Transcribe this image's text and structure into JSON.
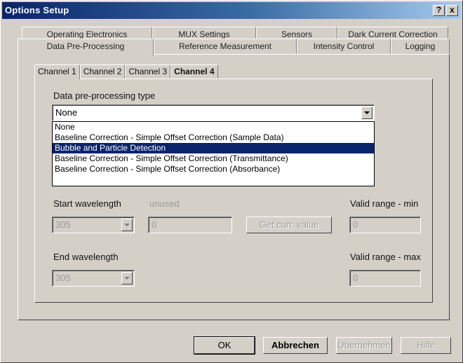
{
  "window": {
    "title": "Options Setup",
    "help_glyph": "?",
    "close_glyph": "x"
  },
  "tabs": {
    "row1": [
      "Operating Electronics",
      "MUX Settings",
      "Sensors",
      "Dark Current Correction"
    ],
    "row2": [
      "Data Pre-Processing",
      "Reference Measurement",
      "Intensity Control",
      "Logging"
    ],
    "selected": "Data Pre-Processing"
  },
  "channels": {
    "tabs": [
      "Channel 1",
      "Channel 2",
      "Channel 3",
      "Channel 4"
    ],
    "selected": "Channel 1"
  },
  "preprocessing": {
    "label": "Data pre-processing type",
    "value": "None",
    "options": [
      "None",
      "Baseline Correction - Simple Offset Correction (Sample Data)",
      "Bubble and Particle Detection",
      "Baseline Correction - Simple Offset Correction (Transmittance)",
      "Baseline Correction - Simple Offset Correction (Absorbance)"
    ],
    "highlighted_index": 2
  },
  "wavelength": {
    "start_label": "Start wavelength",
    "start_value": "305",
    "unused_label": "unused",
    "unused_value": "0",
    "get_curr_value_label": "Get curr. value",
    "valid_min_label": "Valid range - min",
    "valid_min_value": "0",
    "end_label": "End wavelength",
    "end_value": "305",
    "valid_max_label": "Valid range - max",
    "valid_max_value": "0"
  },
  "buttons": {
    "ok": "OK",
    "cancel": "Abbrechen",
    "apply": "Übernehmen",
    "help": "Hilfe"
  }
}
